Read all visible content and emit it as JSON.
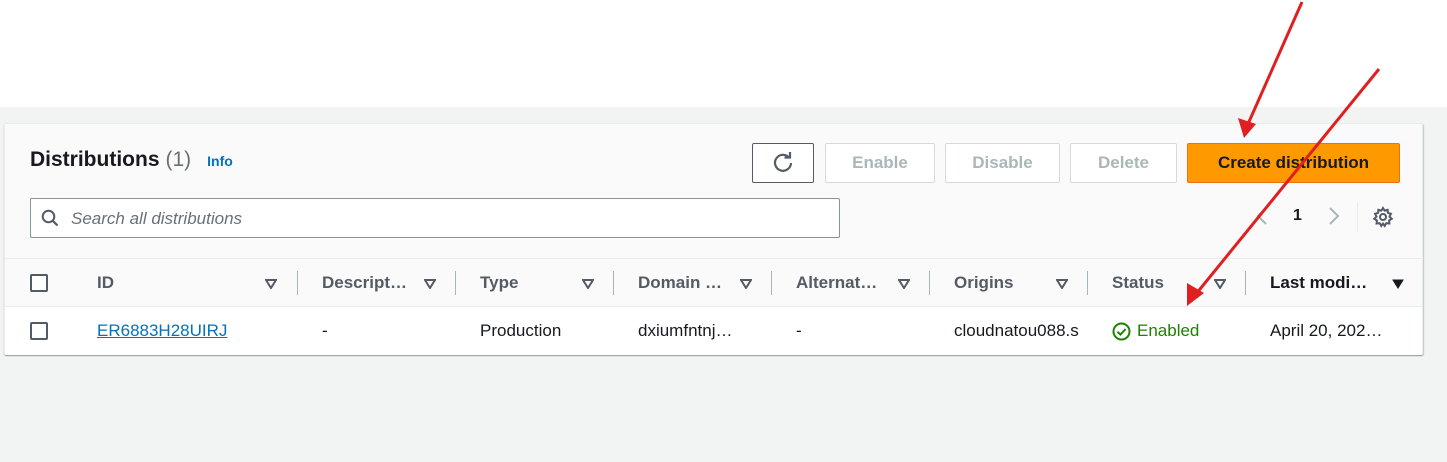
{
  "header": {
    "title": "Distributions",
    "count": "(1)",
    "info": "Info"
  },
  "toolbar": {
    "refresh_icon": "refresh-icon",
    "enable_label": "Enable",
    "disable_label": "Disable",
    "delete_label": "Delete",
    "create_label": "Create distribution"
  },
  "search": {
    "placeholder": "Search all distributions",
    "value": ""
  },
  "pagination": {
    "current_page": "1"
  },
  "table": {
    "columns": [
      "ID",
      "Descript…",
      "Type",
      "Domain …",
      "Alternat…",
      "Origins",
      "Status",
      "Last modi…"
    ],
    "rows": [
      {
        "id": "ER6883H28UIRJ",
        "description": "-",
        "type": "Production",
        "domain": "dxiumfntnj…",
        "alternate": "-",
        "origins": "cloudnatou088.s",
        "status": "Enabled",
        "last_modified": "April 20, 202…"
      }
    ]
  },
  "colors": {
    "accent": "#ff9900",
    "link": "#0073bb",
    "status_ok": "#1d8102",
    "annotation_arrow": "#e02020"
  }
}
